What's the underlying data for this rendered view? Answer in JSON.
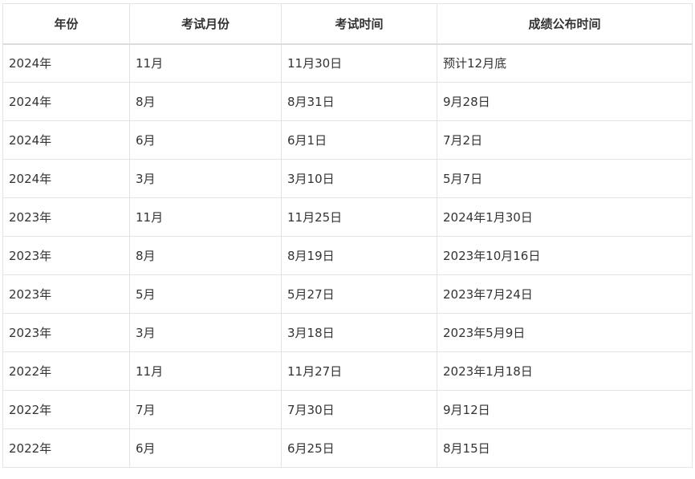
{
  "table": {
    "headers": [
      "年份",
      "考试月份",
      "考试时间",
      "成绩公布时间"
    ],
    "rows": [
      [
        "2024年",
        "11月",
        "11月30日",
        "预计12月底"
      ],
      [
        "2024年",
        "8月",
        "8月31日",
        "9月28日"
      ],
      [
        "2024年",
        "6月",
        "6月1日",
        "7月2日"
      ],
      [
        "2024年",
        "3月",
        "3月10日",
        "5月7日"
      ],
      [
        "2023年",
        "11月",
        "11月25日",
        "2024年1月30日"
      ],
      [
        "2023年",
        "8月",
        "8月19日",
        "2023年10月16日"
      ],
      [
        "2023年",
        "5月",
        "5月27日",
        "2023年7月24日"
      ],
      [
        "2023年",
        "3月",
        "3月18日",
        "2023年5月9日"
      ],
      [
        "2022年",
        "11月",
        "11月27日",
        "2023年1月18日"
      ],
      [
        "2022年",
        "7月",
        "7月30日",
        "9月12日"
      ],
      [
        "2022年",
        "6月",
        "6月25日",
        "8月15日"
      ]
    ]
  }
}
